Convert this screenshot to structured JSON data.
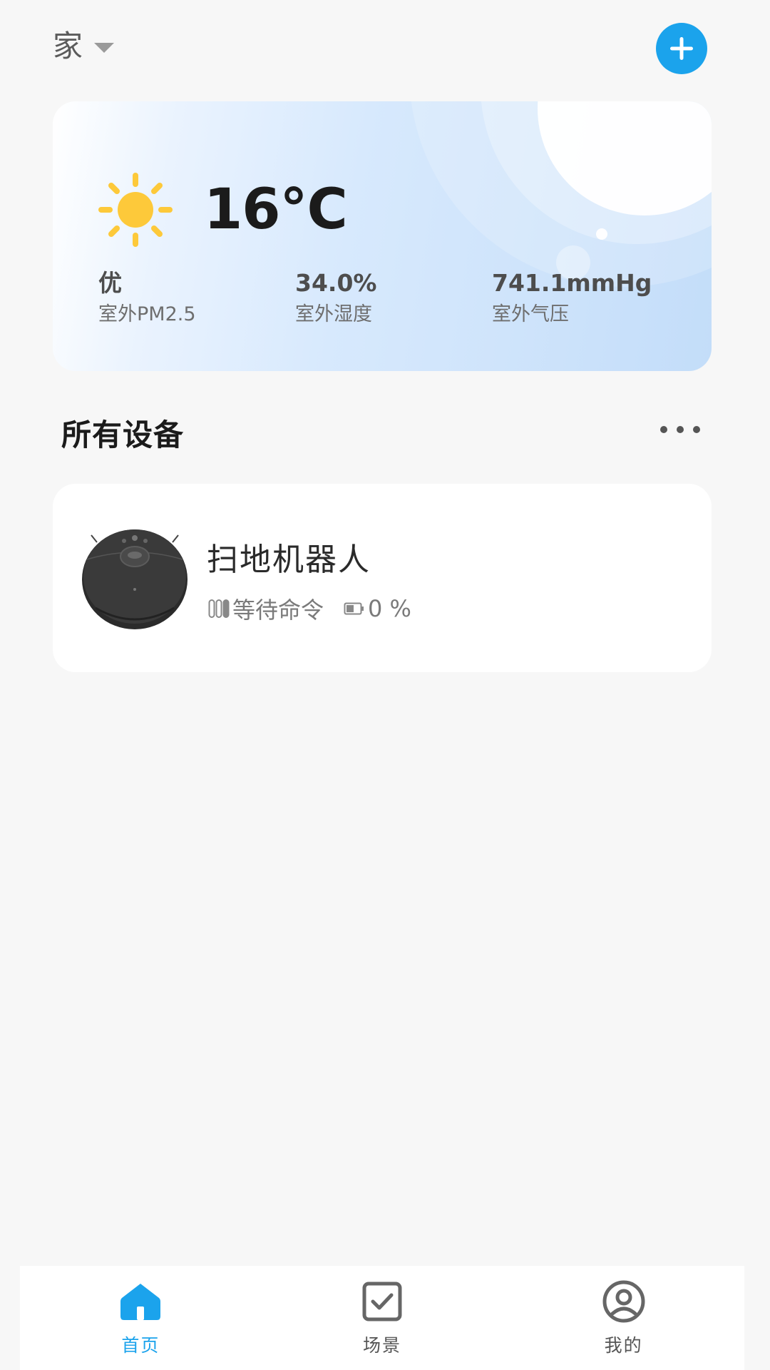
{
  "header": {
    "home_name": "家",
    "add_button_icon": "plus-icon"
  },
  "weather": {
    "icon": "sun-icon",
    "temperature": "16°C",
    "stats": [
      {
        "value": "优",
        "label": "室外PM2.5"
      },
      {
        "value": "34.0%",
        "label": "室外湿度"
      },
      {
        "value": "741.1mmHg",
        "label": "室外气压"
      }
    ]
  },
  "devices_section": {
    "title": "所有设备",
    "more_icon": "more-horizontal-icon"
  },
  "devices": [
    {
      "name": "扫地机器人",
      "status": "等待命令",
      "battery": "0 %",
      "image": "robot-vacuum-image"
    }
  ],
  "nav": {
    "items": [
      {
        "label": "首页",
        "icon": "home-icon",
        "active": true
      },
      {
        "label": "场景",
        "icon": "checkbox-icon",
        "active": false
      },
      {
        "label": "我的",
        "icon": "profile-icon",
        "active": false
      }
    ]
  },
  "colors": {
    "accent": "#1ba3ec",
    "background": "#f7f7f7",
    "sun": "#fdc93a"
  }
}
